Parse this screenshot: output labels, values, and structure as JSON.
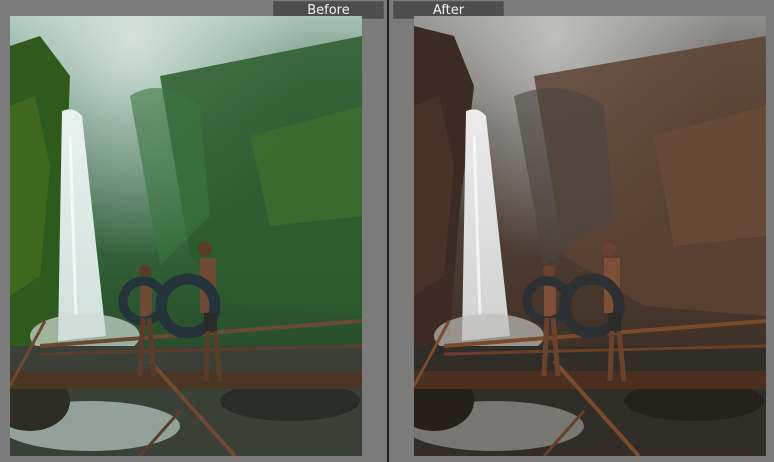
{
  "comparison": {
    "before_label": "Before",
    "after_label": "After"
  },
  "colors": {
    "background": "#7b7b7b",
    "divider": "#1f1f1f",
    "tab_bg": "#4d4d4d",
    "tab_text": "#f2f2f2"
  },
  "photo": {
    "subject": "waterfall-with-two-people-holding-inner-tubes",
    "before_grade": "green-teal",
    "after_grade": "brown-desaturated"
  }
}
